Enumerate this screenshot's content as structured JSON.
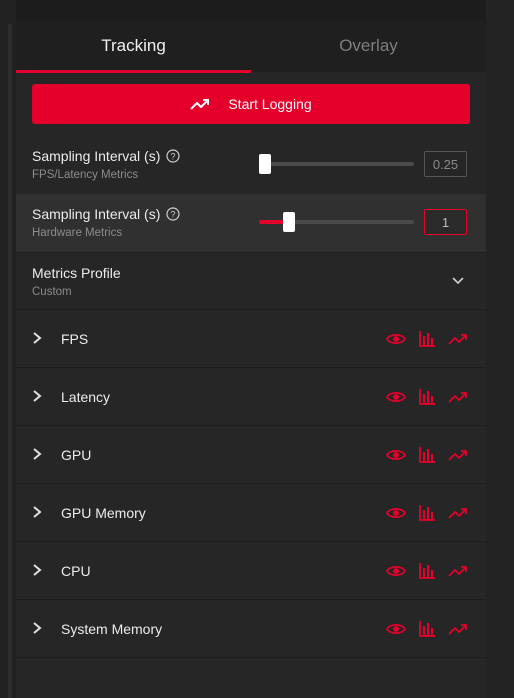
{
  "tabs": [
    {
      "label": "Tracking",
      "active": true
    },
    {
      "label": "Overlay",
      "active": false
    }
  ],
  "start_button": {
    "label": "Start Logging",
    "icon": "trending-up-icon"
  },
  "settings": [
    {
      "label": "Sampling Interval (s)",
      "sublabel": "FPS/Latency Metrics",
      "value": "0.25",
      "slider_fraction": 0.0
    },
    {
      "label": "Sampling Interval (s)",
      "sublabel": "Hardware Metrics",
      "value": "1",
      "slider_fraction": 0.17
    }
  ],
  "profile": {
    "label": "Metrics Profile",
    "value": "Custom"
  },
  "metrics": [
    {
      "name": "FPS"
    },
    {
      "name": "Latency"
    },
    {
      "name": "GPU"
    },
    {
      "name": "GPU Memory"
    },
    {
      "name": "CPU"
    },
    {
      "name": "System Memory"
    }
  ],
  "colors": {
    "accent": "#e4002b",
    "panel": "#262626",
    "text": "#ececec",
    "muted": "#8c8c8c"
  }
}
